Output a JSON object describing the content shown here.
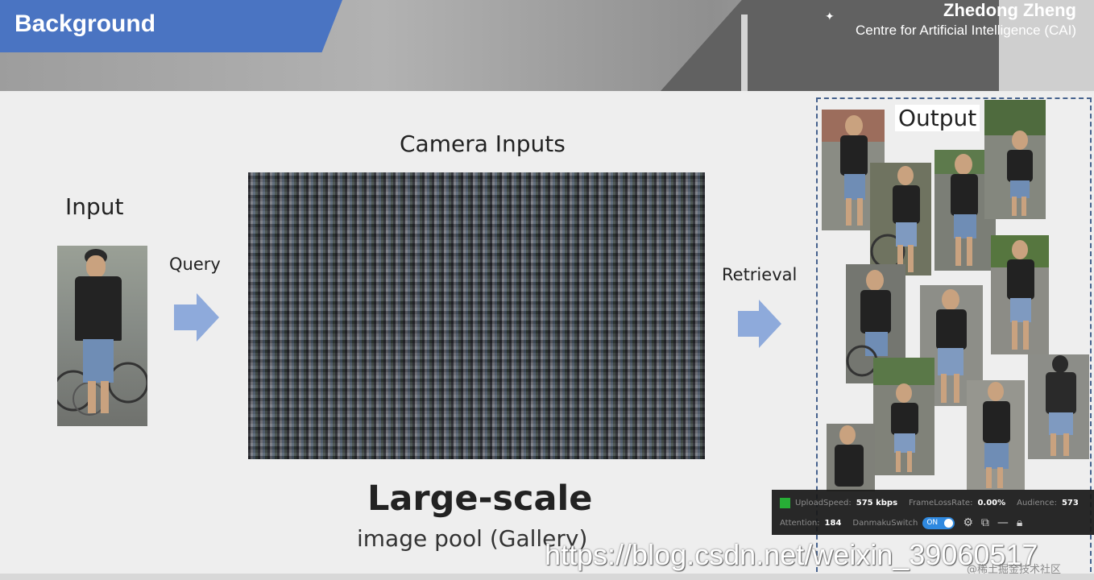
{
  "header": {
    "section_title": "Background",
    "author_name": "Zhedong Zheng",
    "author_org": "Centre for Artificial Intelligence (CAI)"
  },
  "slide": {
    "input_label": "Input",
    "query_label": "Query",
    "camera_inputs_label": "Camera Inputs",
    "retrieval_label": "Retrieval",
    "output_label": "Output",
    "large_scale_label": "Large-scale",
    "gallery_label": "image pool (Gallery)"
  },
  "stream_stats": {
    "upload_speed_key": "UploadSpeed:",
    "upload_speed_value": "575 kbps",
    "frame_loss_key": "FrameLossRate:",
    "frame_loss_value": "0.00%",
    "audience_key": "Audience:",
    "audience_value": "573",
    "attention_key": "Attention:",
    "attention_value": "184",
    "danmaku_key": "DanmakuSwitch",
    "danmaku_state": "ON"
  },
  "watermark": {
    "url": "https://blog.csdn.net/weixin_39060517",
    "sub": "@稀土掘金技术社区"
  },
  "colors": {
    "tab_blue": "#4a74c2",
    "arrow_blue": "#8eaadb",
    "output_border": "#46628e",
    "stream_green": "#27ae36",
    "toggle_blue": "#2f89e0"
  }
}
